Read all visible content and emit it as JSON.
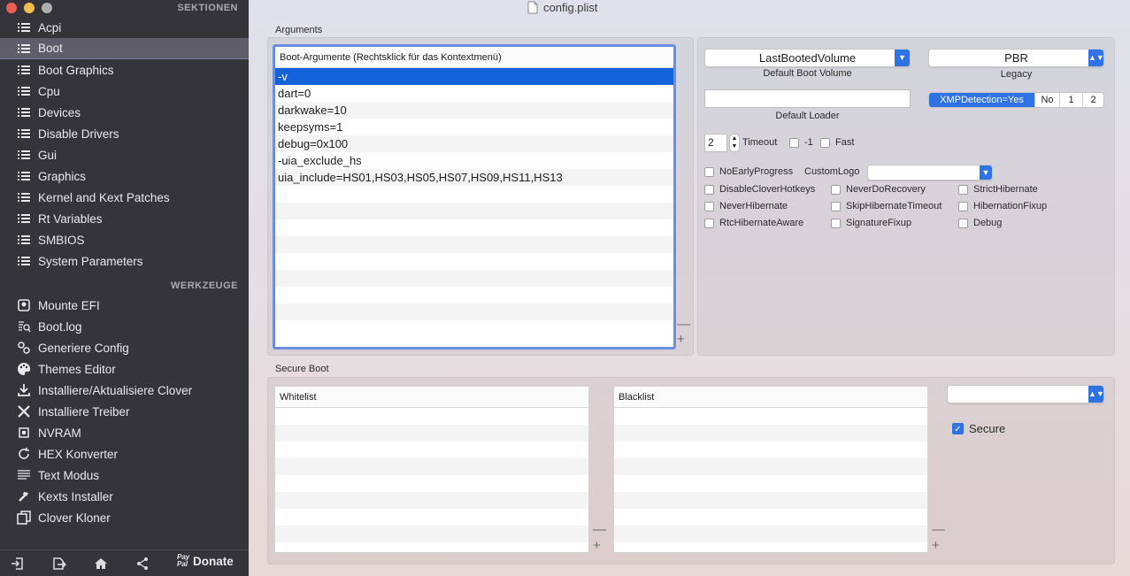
{
  "window": {
    "title": "config.plist",
    "file_icon": "document-icon"
  },
  "sidebar": {
    "sections_title": "SEKTIONEN",
    "sections": [
      {
        "label": "Acpi",
        "icon": "list-icon"
      },
      {
        "label": "Boot",
        "icon": "list-icon",
        "selected": true
      },
      {
        "label": "Boot Graphics",
        "icon": "list-icon"
      },
      {
        "label": "Cpu",
        "icon": "list-icon"
      },
      {
        "label": "Devices",
        "icon": "list-icon"
      },
      {
        "label": "Disable Drivers",
        "icon": "list-icon"
      },
      {
        "label": "Gui",
        "icon": "list-icon"
      },
      {
        "label": "Graphics",
        "icon": "list-icon"
      },
      {
        "label": "Kernel and Kext Patches",
        "icon": "list-icon"
      },
      {
        "label": "Rt Variables",
        "icon": "list-icon"
      },
      {
        "label": "SMBIOS",
        "icon": "list-icon"
      },
      {
        "label": "System Parameters",
        "icon": "list-icon"
      }
    ],
    "tools_title": "WERKZEUGE",
    "tools": [
      {
        "label": "Mounte EFI",
        "icon": "disk-icon"
      },
      {
        "label": "Boot.log",
        "icon": "log-search-icon"
      },
      {
        "label": "Generiere Config",
        "icon": "gears-icon"
      },
      {
        "label": "Themes Editor",
        "icon": "palette-icon"
      },
      {
        "label": "Installiere/Aktualisiere Clover",
        "icon": "download-icon"
      },
      {
        "label": "Installiere Treiber",
        "icon": "tools-icon"
      },
      {
        "label": "NVRAM",
        "icon": "chip-icon"
      },
      {
        "label": "HEX Konverter",
        "icon": "refresh-icon"
      },
      {
        "label": "Text Modus",
        "icon": "text-lines-icon"
      },
      {
        "label": "Kexts Installer",
        "icon": "hammer-icon"
      },
      {
        "label": "Clover Kloner",
        "icon": "copy-icon"
      }
    ],
    "bottom": {
      "paypal": "Pay Pal",
      "donate": "Donate"
    }
  },
  "arguments": {
    "group_label": "Arguments",
    "header": "Boot-Argumente (Rechtsklick für das Kontextmenü)",
    "rows": [
      "-v",
      "dart=0",
      "darkwake=10",
      "keepsyms=1",
      "debug=0x100",
      "-uia_exclude_hs",
      "uia_include=HS01,HS03,HS05,HS07,HS09,HS11,HS13"
    ],
    "selected_index": 0,
    "minus": "—",
    "plus": "+"
  },
  "boot_settings": {
    "default_volume_value": "LastBootedVolume",
    "default_volume_caption": "Default Boot Volume",
    "legacy_value": "PBR",
    "legacy_caption": "Legacy",
    "default_loader_caption": "Default Loader",
    "default_loader_value": "",
    "xmp_options": [
      "XMPDetection=Yes",
      "No",
      "1",
      "2"
    ],
    "timeout_value": "2",
    "timeout_label": "Timeout",
    "minus_one_label": "-1",
    "fast_label": "Fast",
    "no_early_progress": "NoEarlyProgress",
    "custom_logo_label": "CustomLogo",
    "custom_logo_value": "",
    "checkboxes": [
      "DisableCloverHotkeys",
      "NeverDoRecovery",
      "StrictHibernate",
      "NeverHibernate",
      "SkipHibernateTimeout",
      "HibernationFixup",
      "RtcHibernateAware",
      "SignatureFixup",
      "Debug"
    ]
  },
  "secure_boot": {
    "group_label": "Secure Boot",
    "whitelist_header": "Whitelist",
    "blacklist_header": "Blacklist",
    "policy_value": "",
    "secure_label": "Secure",
    "secure_checked": true,
    "minus": "—",
    "plus": "+"
  },
  "colors": {
    "sidebar_bg": "#353539",
    "selection": "#1362d9",
    "accent": "#2e72e6"
  }
}
